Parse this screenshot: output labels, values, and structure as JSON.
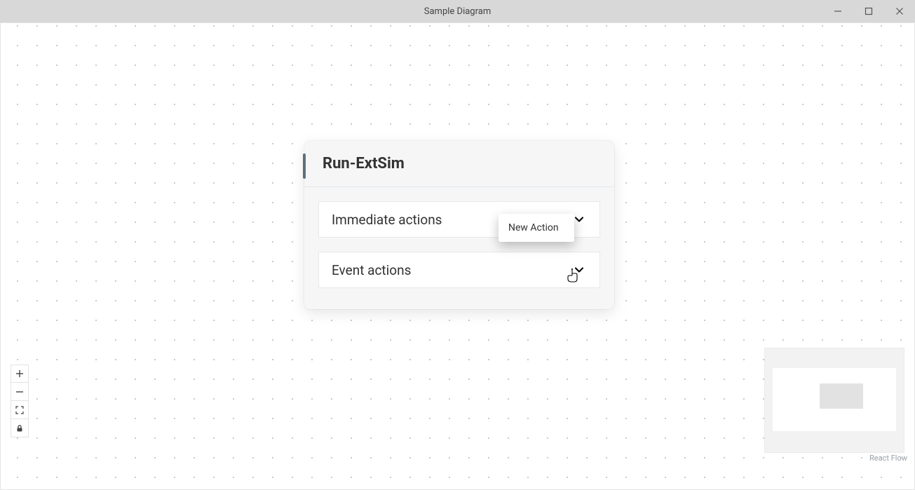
{
  "window": {
    "title": "Sample Diagram"
  },
  "node": {
    "title": "Run-ExtSim",
    "sections": [
      {
        "label": "Immediate actions",
        "expanded": true
      },
      {
        "label": "Event actions",
        "expanded": false
      }
    ]
  },
  "context_menu": {
    "items": [
      {
        "label": "New Action"
      }
    ]
  },
  "attribution": "React Flow",
  "icons": {
    "minimize": "minimize-icon",
    "maximize": "maximize-icon",
    "close": "close-icon",
    "chevron_down": "chevron-down-icon",
    "plus": "plus-icon",
    "minus": "minus-icon",
    "fit": "fit-view-icon",
    "lock": "lock-icon"
  }
}
